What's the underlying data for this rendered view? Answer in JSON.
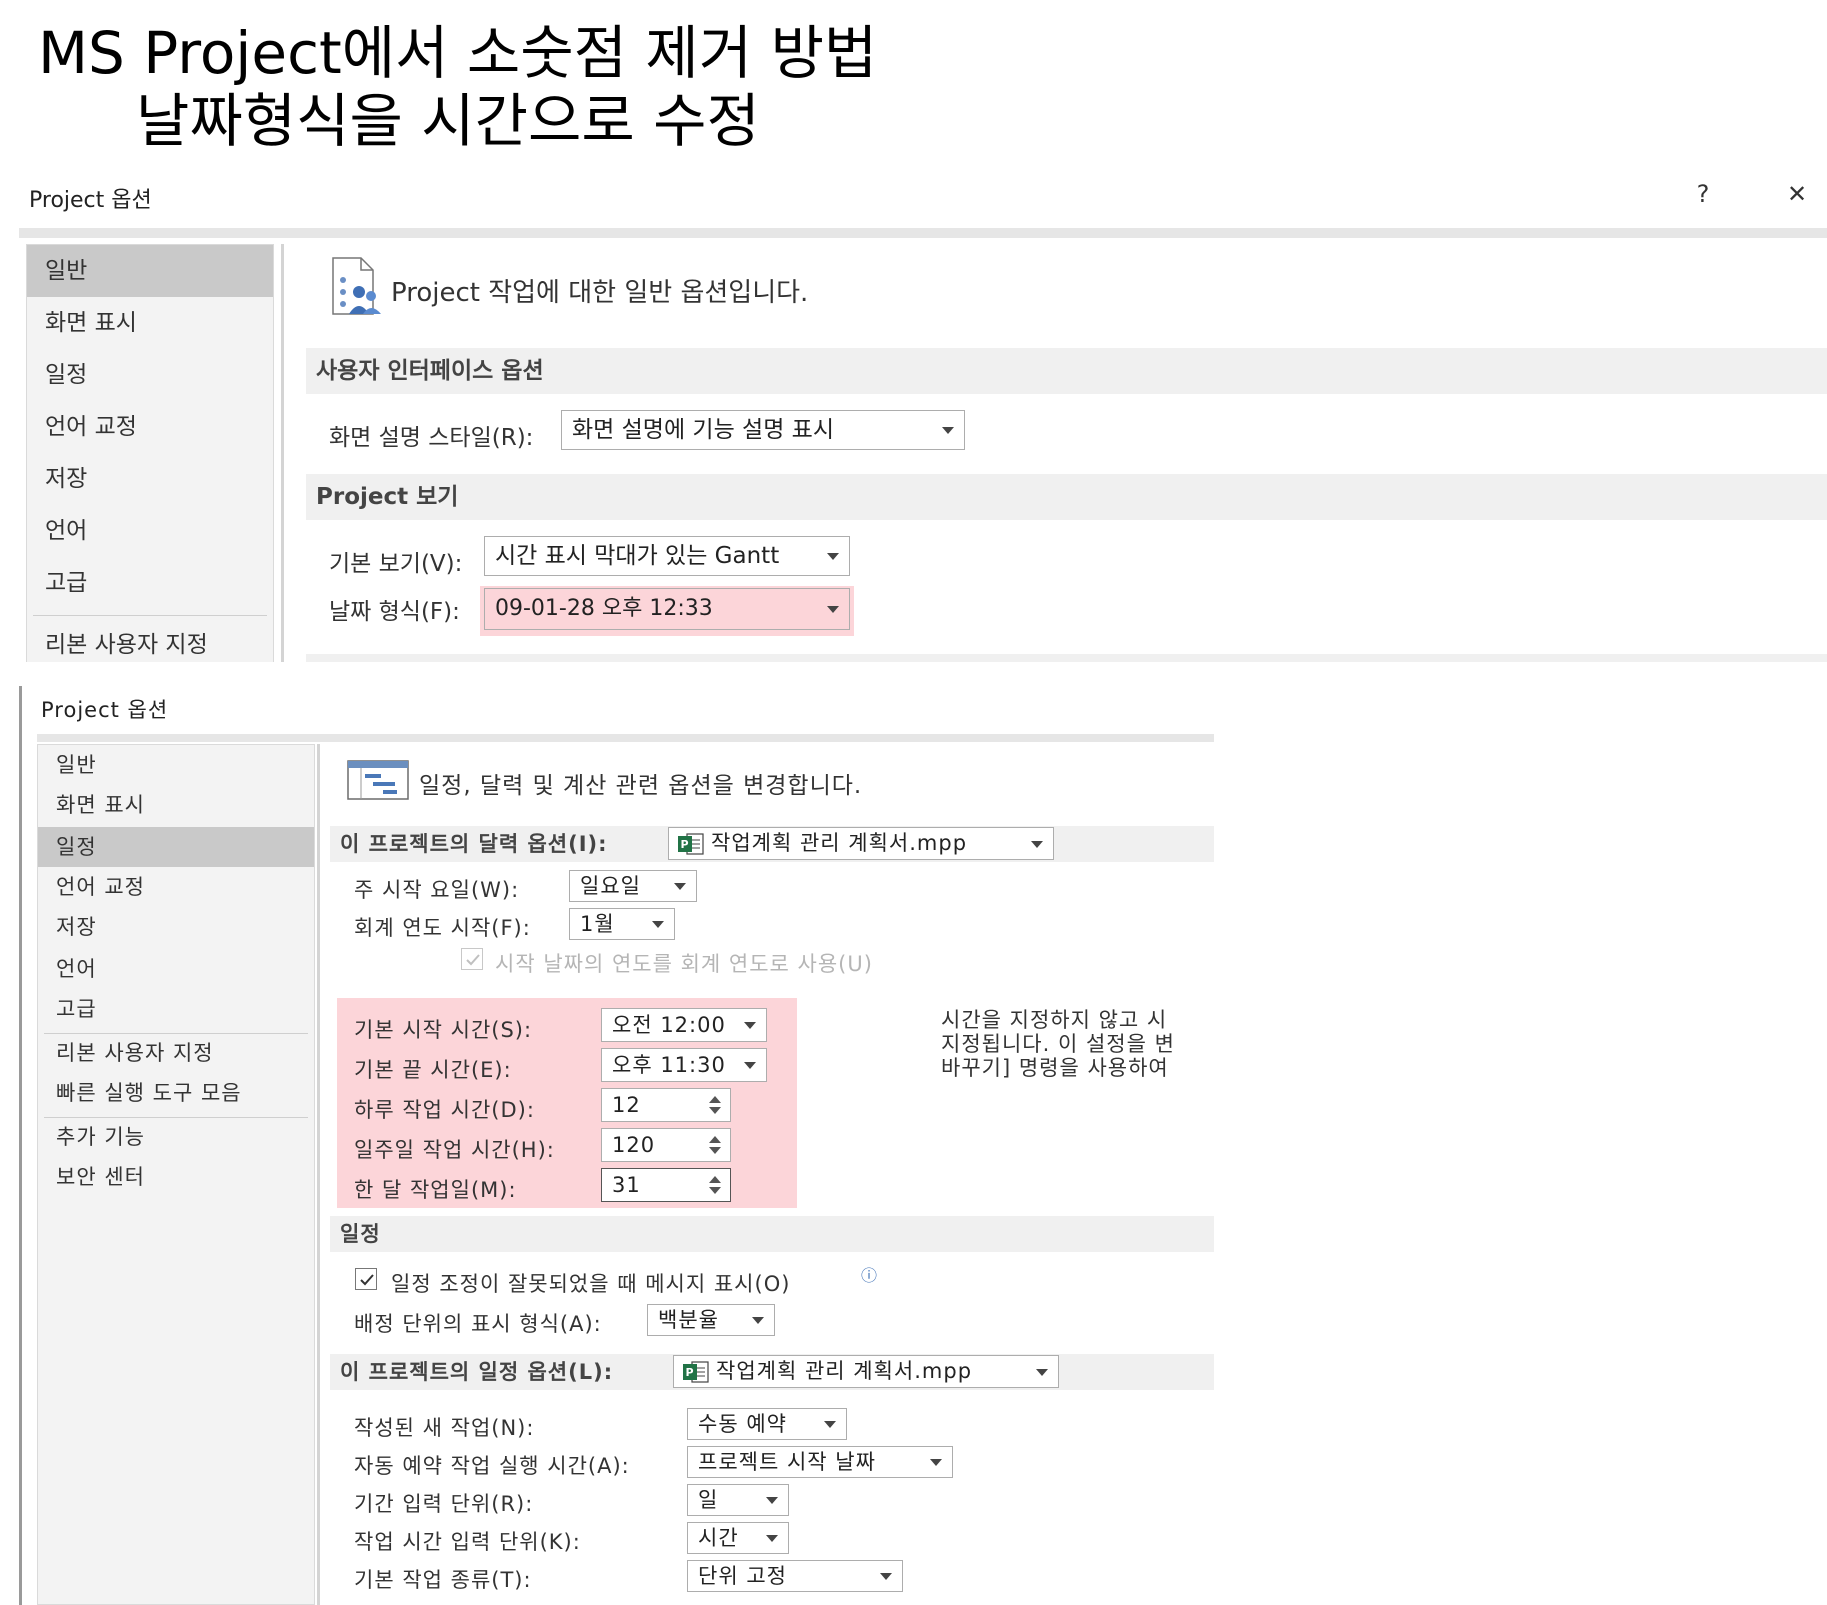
{
  "slide": {
    "title_line1": "MS Project에서 소숫점 제거 방법",
    "title_line2": "날짜형식을 시간으로 수정"
  },
  "dialog1": {
    "title": "Project 옵션",
    "help_label": "?",
    "close_label": "✕",
    "nav_items": [
      "일반",
      "화면 표시",
      "일정",
      "언어 교정",
      "저장",
      "언어",
      "고급",
      "리본 사용자 지정"
    ],
    "header_text": "Project 작업에 대한 일반 옵션입니다.",
    "section_ui": "사용자 인터페이스 옵션",
    "tooltip_style_label": "화면 설명 스타일(R):",
    "tooltip_style_value": "화면 설명에 기능 설명 표시",
    "section_view": "Project 보기",
    "default_view_label": "기본 보기(V):",
    "default_view_value": "시간 표시 막대가 있는 Gantt",
    "date_format_label": "날짜 형식(F):",
    "date_format_value": "09-01-28 오후 12:33"
  },
  "dialog2": {
    "title": "Project 옵션",
    "nav_items": [
      "일반",
      "화면 표시",
      "일정",
      "언어 교정",
      "저장",
      "언어",
      "고급",
      "리본 사용자 지정",
      "빠른 실행 도구 모음",
      "추가 기능",
      "보안 센터"
    ],
    "header_text": "일정, 달력 및 계산 관련 옵션을 변경합니다.",
    "calendar_section_label": "이 프로젝트의 달력 옵션(I):",
    "calendar_project_file": "작업계획 관리 계획서.mpp",
    "week_start_label": "주 시작 요일(W):",
    "week_start_value": "일요일",
    "fiscal_year_label": "회계 연도 시작(F):",
    "fiscal_year_value": "1월",
    "use_start_year_label": "시작 날짜의 연도를 회계 연도로 사용(U)",
    "default_start_label": "기본 시작 시간(S):",
    "default_start_value": "오전 12:00",
    "default_end_label": "기본 끝 시간(E):",
    "default_end_value": "오후 11:30",
    "hours_per_day_label": "하루 작업 시간(D):",
    "hours_per_day_value": "12",
    "hours_per_week_label": "일주일 작업 시간(H):",
    "hours_per_week_value": "120",
    "days_per_month_label": "한 달 작업일(M):",
    "days_per_month_value": "31",
    "note_line1": "시간을 지정하지 않고 시",
    "note_line2": "지정됩니다. 이 설정을 변",
    "note_line3": "바꾸기] 명령을 사용하여",
    "section_schedule": "일정",
    "show_schedule_msg_label": "일정 조정이 잘못되었을 때 메시지 표시(O)",
    "info_icon_text": "ⓘ",
    "assignment_units_label": "배정 단위의 표시 형식(A):",
    "assignment_units_value": "백분율",
    "schedule_options_label": "이 프로젝트의 일정 옵션(L):",
    "schedule_project_file": "작업계획 관리 계획서.mpp",
    "new_tasks_label": "작성된 새 작업(N):",
    "new_tasks_value": "수동 예약",
    "auto_tasks_label": "자동 예약 작업 실행 시간(A):",
    "auto_tasks_value": "프로젝트 시작 날짜",
    "duration_unit_label": "기간 입력 단위(R):",
    "duration_unit_value": "일",
    "work_unit_label": "작업 시간 입력 단위(K):",
    "work_unit_value": "시간",
    "task_type_label": "기본 작업 종류(T):",
    "task_type_value": "단위 고정"
  },
  "colors": {
    "highlight": "#fcd5d9",
    "nav_selected": "#c9c9c9",
    "section_bar": "#f0f0f0",
    "project_icon_green": "#217346"
  }
}
